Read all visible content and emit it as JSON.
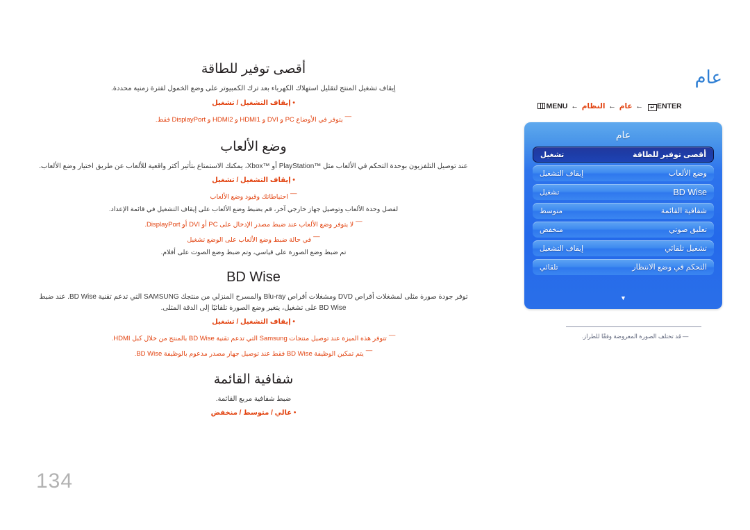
{
  "page": {
    "number": "134"
  },
  "osd": {
    "title": "عام",
    "breadcrumb": {
      "menu_icon": "menu-grid-icon",
      "menu_label": "MENU",
      "arrow": "←",
      "step1": "النظام",
      "step2": "عام",
      "enter_label": "ENTER",
      "enter_icon": "enter-key-icon"
    },
    "panel": {
      "header": "عام",
      "rows": [
        {
          "label": "أقصى توفير للطاقة",
          "value": "تشغيل",
          "selected": true,
          "latin": false
        },
        {
          "label": "وضع الألعاب",
          "value": "إيقاف التشغيل",
          "selected": false,
          "latin": false
        },
        {
          "label": "BD Wise",
          "value": "تشغيل",
          "selected": false,
          "latin": true
        },
        {
          "label": "شفافية القائمة",
          "value": "متوسط",
          "selected": false,
          "latin": false
        },
        {
          "label": "تعليق صوتي",
          "value": "منخفض",
          "selected": false,
          "latin": false
        },
        {
          "label": "تشغيل تلقائي",
          "value": "إيقاف التشغيل",
          "selected": false,
          "latin": false
        },
        {
          "label": "التحكم في وضع الانتظار",
          "value": "تلقائي",
          "selected": false,
          "latin": false
        }
      ],
      "scroll_arrow": "▼"
    },
    "footnote": "قد تختلف الصورة المعروضة وفقًا للطراز."
  },
  "sections": [
    {
      "id": "max-power-saving",
      "title": "أقصى توفير للطاقة",
      "latin_title": false,
      "desc": "إيقاف تشغيل المنتج لتقليل استهلاك الكهرباء بعد ترك الكمبيوتر على وضع الخمول لفترة زمنية محددة.",
      "options": "إيقاف التشغيل / تشغيل",
      "notes": [
        "يتوفر في الأوضاع PC و DVI و HDMI1 و HDMI2 و DisplayPort فقط."
      ]
    },
    {
      "id": "game-mode",
      "title": "وضع الألعاب",
      "latin_title": false,
      "desc": "عند توصيل التلفزيون بوحدة التحكم في الألعاب مثل ™PlayStation أو ™Xbox، يمكنك الاستمتاع بتأثير أكثر واقعية للألعاب عن طريق اختيار وضع الألعاب.",
      "options": "إيقاف التشغيل / تشغيل",
      "notes": [
        "احتياطاتك وقيود وضع الألعاب",
        "لفصل وحدة الألعاب وتوصيل جهاز خارجي آخر، قم بضبط وضع الألعاب على إيقاف التشغيل في قائمة الإعداد.",
        "لا يتوفر وضع الألعاب عند ضبط مصدر الإدخال على PC أو DVI أو DisplayPort.",
        "في حالة ضبط وضع الألعاب على الوضع تشغيل",
        "تم ضبط وضع الصورة على قياسي، وتم ضبط وضع الصوت على أفلام."
      ]
    },
    {
      "id": "bd-wise",
      "title": "BD Wise",
      "latin_title": true,
      "desc": "توفر جودة صورة مثلى لمشغلات أقراص DVD ومشغلات أقراص Blu-ray والمسرح المنزلي من منتجك SAMSUNG التي تدعم تقنية BD Wise. عند ضبط BD Wise على تشغيل، يتغير وضع الصورة تلقائيًا إلى الدقة المثلى.",
      "options": "إيقاف التشغيل / تشغيل",
      "notes": [
        "تتوفر هذه الميزة عند توصيل منتجات Samsung التي تدعم تقنية BD Wise بالمنتج من خلال كبل HDMI.",
        "يتم تمكين الوظيفة BD Wise فقط عند توصيل جهاز مصدر مدعوم بالوظيفة BD Wise."
      ]
    },
    {
      "id": "menu-transparency",
      "title": "شفافية القائمة",
      "latin_title": false,
      "desc": "ضبط شفافية مربع القائمة.",
      "options": "عالي / متوسط / منخفض",
      "notes": []
    }
  ],
  "colors": {
    "accent_red": "#e24310",
    "osd_title_blue": "#2f7fd4",
    "panel_blue": "#2469ea",
    "selected_navy": "#1d3da8",
    "page_number_gray": "#b2b2b2"
  }
}
